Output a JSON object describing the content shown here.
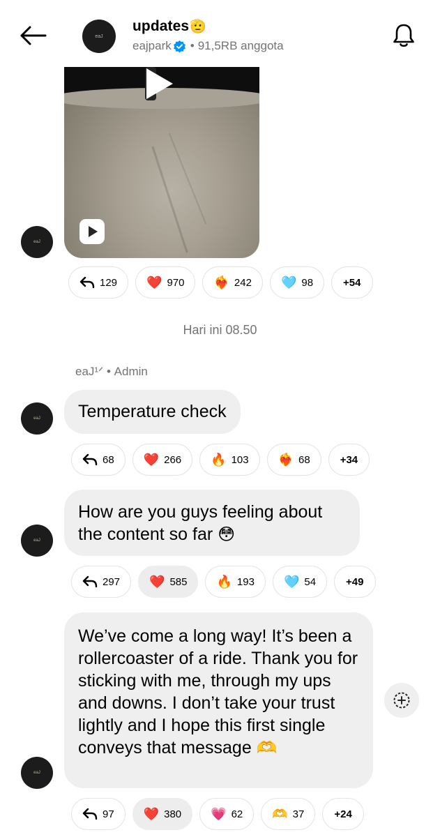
{
  "header": {
    "title": "updates",
    "title_emoji": "🫡",
    "username": "eajpark",
    "separator": "•",
    "members": "91,5RB anggota",
    "avatar_text": "eaJ"
  },
  "avatar_text": "eaJ",
  "video_message": {
    "reactions": [
      {
        "icon": "reply-icon",
        "emoji": "",
        "count": "129",
        "selected": false
      },
      {
        "icon": "heart-emoji",
        "emoji": "❤️",
        "count": "970",
        "selected": false
      },
      {
        "icon": "heart-on-fire-emoji",
        "emoji": "❤️‍🔥",
        "count": "242",
        "selected": false
      },
      {
        "icon": "light-blue-heart-emoji",
        "emoji": "🩵",
        "count": "98",
        "selected": false
      },
      {
        "icon": "",
        "emoji": "",
        "count": "+54",
        "selected": false
      }
    ]
  },
  "timestamp": "Hari ini 08.50",
  "sender_line": "eaJ¹ᐟ • Admin",
  "messages": [
    {
      "text": "Temperature check",
      "emoji": "",
      "reactions": [
        {
          "icon": "reply-icon",
          "emoji": "",
          "count": "68",
          "selected": false
        },
        {
          "icon": "heart-emoji",
          "emoji": "❤️",
          "count": "266",
          "selected": false
        },
        {
          "icon": "fire-emoji",
          "emoji": "🔥",
          "count": "103",
          "selected": false
        },
        {
          "icon": "heart-on-fire-emoji",
          "emoji": "❤️‍🔥",
          "count": "68",
          "selected": false
        },
        {
          "icon": "",
          "emoji": "",
          "count": "+34",
          "selected": false
        }
      ]
    },
    {
      "text": "How are you guys feeling about the content so far",
      "emoji": "😳",
      "reactions": [
        {
          "icon": "reply-icon",
          "emoji": "",
          "count": "297",
          "selected": false
        },
        {
          "icon": "heart-emoji",
          "emoji": "❤️",
          "count": "585",
          "selected": true
        },
        {
          "icon": "fire-emoji",
          "emoji": "🔥",
          "count": "193",
          "selected": false
        },
        {
          "icon": "light-blue-heart-emoji",
          "emoji": "🩵",
          "count": "54",
          "selected": false
        },
        {
          "icon": "",
          "emoji": "",
          "count": "+49",
          "selected": false
        }
      ]
    },
    {
      "text": "We’ve come a long way! It’s been a rollercoaster of a ride. Thank you for sticking with me, through my ups and downs. I don’t take your trust lightly and I hope this first single conveys that message",
      "emoji": "🫶",
      "reactions": [
        {
          "icon": "reply-icon",
          "emoji": "",
          "count": "97",
          "selected": false
        },
        {
          "icon": "heart-emoji",
          "emoji": "❤️",
          "count": "380",
          "selected": true
        },
        {
          "icon": "pink-heart-emoji",
          "emoji": "💗",
          "count": "62",
          "selected": false
        },
        {
          "icon": "heart-hands-emoji",
          "emoji": "🫶",
          "count": "37",
          "selected": false
        },
        {
          "icon": "",
          "emoji": "",
          "count": "+24",
          "selected": false
        }
      ]
    }
  ]
}
